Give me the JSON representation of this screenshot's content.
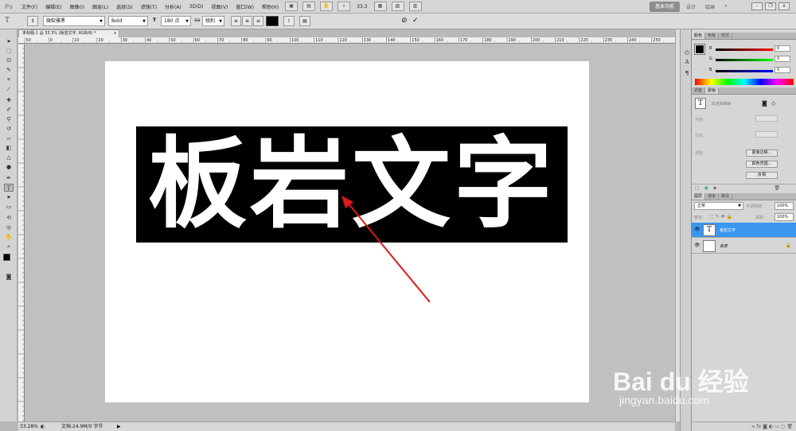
{
  "app": {
    "logo": "Ps"
  },
  "menu": [
    "文件(F)",
    "编辑(E)",
    "图像(I)",
    "图层(L)",
    "选择(S)",
    "滤镜(T)",
    "分析(A)",
    "3D(D)",
    "视图(V)",
    "窗口(W)",
    "帮助(H)"
  ],
  "menubar_right": {
    "zoom": "33.3",
    "workspace": "基本功能",
    "design": "设计",
    "painting": "绘画",
    "more": "»",
    "minimize": "-",
    "restore": "❐",
    "close": "x"
  },
  "options": {
    "font_family": "微软雅黑",
    "font_style": "Bold",
    "font_size": "180 点",
    "aa_label": "aa",
    "antialias": "锐利",
    "cancel": "⊘",
    "commit": "✓"
  },
  "document": {
    "tab_title": "未标题-1 @ 33.3% (板岩文字, RGB/8) *",
    "close": "x",
    "canvas_text": "板岩文字",
    "ruler_ticks": [
      "50",
      "0",
      "10",
      "20",
      "30",
      "40",
      "50",
      "60",
      "70",
      "80",
      "90",
      "100",
      "110",
      "120",
      "130",
      "140",
      "150",
      "160",
      "170",
      "180",
      "190",
      "200",
      "210",
      "220",
      "230",
      "240",
      "250"
    ]
  },
  "status": {
    "zoom": "33.28%",
    "doc_info": "文档:24.9M/0 字节"
  },
  "color_panel": {
    "tabs": [
      "颜色",
      "色板",
      "样式"
    ],
    "r": {
      "label": "R",
      "value": "0"
    },
    "g": {
      "label": "G",
      "value": "0"
    },
    "b": {
      "label": "B",
      "value": "0"
    }
  },
  "adjust_panel": {
    "tabs": [
      "调整",
      "蒙版"
    ],
    "mask_label": "未选择蒙版",
    "density": "浓度:",
    "feather": "羽化:",
    "refine": "调整:",
    "btn_edge": "蒙版边缘...",
    "btn_color": "颜色范围...",
    "btn_invert": "反相"
  },
  "layers_panel": {
    "tabs": [
      "图层",
      "通道",
      "路径"
    ],
    "blend_mode": "正常",
    "opacity_label": "不透明度:",
    "opacity": "100%",
    "lock_label": "锁定:",
    "fill_label": "填充:",
    "fill": "100%",
    "layers": [
      {
        "name": "板岩文字",
        "thumb": "T",
        "selected": true
      },
      {
        "name": "背景",
        "thumb": "",
        "selected": false
      }
    ]
  },
  "watermark": {
    "brand": "Bai du 经验",
    "url": "jingyan.baidu.com"
  },
  "colors": {
    "accent": "#3d8ee8",
    "selected_layer": "#3b96f0",
    "annotation": "#e0191a"
  }
}
